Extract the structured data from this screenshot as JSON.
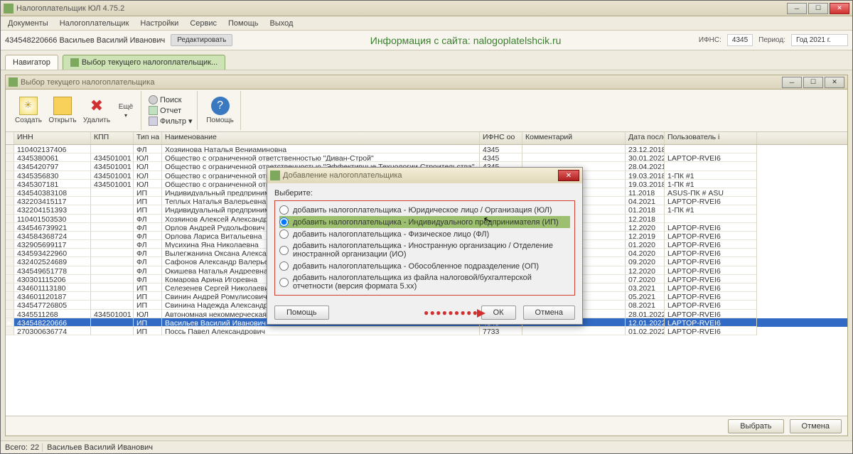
{
  "app": {
    "title": "Налогоплательщик ЮЛ 4.75.2",
    "menus": [
      "Документы",
      "Налогоплательщик",
      "Настройки",
      "Сервис",
      "Помощь",
      "Выход"
    ]
  },
  "strip": {
    "payer": "434548220666 Васильев Василий Иванович",
    "edit": "Редактировать",
    "site": "Информация с сайта: nalogoplatelshcik.ru",
    "ifns_l": "ИФНС:",
    "ifns_v": "4345",
    "period_l": "Период:",
    "period_v": "Год 2021 г."
  },
  "tabs": {
    "navigator": "Навигатор",
    "selector": "Выбор текущего налогоплательщик..."
  },
  "child": {
    "title": "Выбор текущего налогоплательщика"
  },
  "ribbon": {
    "create": "Создать",
    "open": "Открыть",
    "delete": "Удалить",
    "more": "Ещё",
    "help": "Помощь",
    "search": "Поиск",
    "report": "Отчет",
    "filter": "Фильтр ▾"
  },
  "cols": {
    "inn": "ИНН",
    "kpp": "КПП",
    "typ": "Тип на",
    "name": "Наименование",
    "ifns": "ИФНС оо",
    "comm": "Комментарий",
    "date": "Дата последн",
    "user": "Пользователь і"
  },
  "rows": [
    {
      "inn": "110402137406",
      "kpp": "",
      "typ": "ФЛ",
      "name": "Хозяинова Наталья Вениаминовна",
      "ifns": "4345",
      "comm": "",
      "date": "23.12.2018",
      "user": ""
    },
    {
      "inn": "4345380061",
      "kpp": "434501001",
      "typ": "ЮЛ",
      "name": "Общество с ограниченной ответственностью \"Диван-Строй\"",
      "ifns": "4345",
      "comm": "",
      "date": "30.01.2022",
      "user": "LAPTOP-RVEI6"
    },
    {
      "inn": "4345420797",
      "kpp": "434501001",
      "typ": "ЮЛ",
      "name": "Общество с ограниченной ответственностью \"Эффективные Технологии Строительства\"",
      "ifns": "4345",
      "comm": "",
      "date": "28.04.2021",
      "user": ""
    },
    {
      "inn": "4345356830",
      "kpp": "434501001",
      "typ": "ЮЛ",
      "name": "Общество с ограниченной ответственностью \"МегаСтройПлит\"",
      "ifns": "4345",
      "comm": "",
      "date": "19.03.2018",
      "user": "1-ПК #1"
    },
    {
      "inn": "4345307181",
      "kpp": "434501001",
      "typ": "ЮЛ",
      "name": "Общество с ограниченной ответственностью Торговая Компания \"Мегастройплит\"",
      "ifns": "4345",
      "comm": "",
      "date": "19.03.2018",
      "user": "1-ПК #1"
    },
    {
      "inn": "434540383108",
      "kpp": "",
      "typ": "ИП",
      "name": "Индивидуальный предприниматель Трубочкин Паве",
      "ifns": "",
      "comm": "",
      "date": "11.2018",
      "user": "ASUS-ПК # ASU"
    },
    {
      "inn": "432203415117",
      "kpp": "",
      "typ": "ИП",
      "name": "Теплых Наталья Валерьевна",
      "ifns": "",
      "comm": "",
      "date": "04.2021",
      "user": "LAPTOP-RVEI6"
    },
    {
      "inn": "432204151393",
      "kpp": "",
      "typ": "ИП",
      "name": "Индивидуальный предприниматель Коровкин Андре",
      "ifns": "",
      "comm": "",
      "date": "01.2018",
      "user": "1-ПК #1"
    },
    {
      "inn": "110401503530",
      "kpp": "",
      "typ": "ФЛ",
      "name": "Хозяинов Алексей Александрович",
      "ifns": "",
      "comm": "",
      "date": "12.2018",
      "user": ""
    },
    {
      "inn": "434546739921",
      "kpp": "",
      "typ": "ФЛ",
      "name": "Орлов Андрей Рудольфович",
      "ifns": "",
      "comm": "",
      "date": "12.2020",
      "user": "LAPTOP-RVEI6"
    },
    {
      "inn": "434584368724",
      "kpp": "",
      "typ": "ФЛ",
      "name": "Орлова Лариса Витальевна",
      "ifns": "",
      "comm": "",
      "date": "12.2019",
      "user": "LAPTOP-RVEI6"
    },
    {
      "inn": "432905699117",
      "kpp": "",
      "typ": "ФЛ",
      "name": "Мусихина Яна Николаевна",
      "ifns": "",
      "comm": "",
      "date": "01.2020",
      "user": "LAPTOP-RVEI6"
    },
    {
      "inn": "434593422960",
      "kpp": "",
      "typ": "ФЛ",
      "name": "Вылегжанина Оксана Александровна",
      "ifns": "",
      "comm": "",
      "date": "04.2020",
      "user": "LAPTOP-RVEI6"
    },
    {
      "inn": "432402524689",
      "kpp": "",
      "typ": "ФЛ",
      "name": "Сафонов Александр Валерьевич",
      "ifns": "",
      "comm": "",
      "date": "09.2020",
      "user": "LAPTOP-RVEI6"
    },
    {
      "inn": "434549651778",
      "kpp": "",
      "typ": "ФЛ",
      "name": "Окишева Наталья Андреевна",
      "ifns": "",
      "comm": "",
      "date": "12.2020",
      "user": "LAPTOP-RVEI6"
    },
    {
      "inn": "430301115206",
      "kpp": "",
      "typ": "ФЛ",
      "name": "Комарова Арина Игоревна",
      "ifns": "",
      "comm": "",
      "date": "07.2020",
      "user": "LAPTOP-RVEI6"
    },
    {
      "inn": "434601113180",
      "kpp": "",
      "typ": "ИП",
      "name": "Селезенев Сергей Николаевич",
      "ifns": "",
      "comm": "",
      "date": "03.2021",
      "user": "LAPTOP-RVEI6"
    },
    {
      "inn": "434601120187",
      "kpp": "",
      "typ": "ИП",
      "name": "Свинин Андрей Ромулисович",
      "ifns": "",
      "comm": "",
      "date": "05.2021",
      "user": "LAPTOP-RVEI6"
    },
    {
      "inn": "434547726805",
      "kpp": "",
      "typ": "ИП",
      "name": "Свинина Надежда Александровна",
      "ifns": "",
      "comm": "",
      "date": "08.2021",
      "user": "LAPTOP-RVEI6"
    },
    {
      "inn": "4345511268",
      "kpp": "434501001",
      "typ": "ЮЛ",
      "name": "Автономная некоммерческая организация \"Центр по оказанию услуг  развития и коррекции высших психических фу 4345",
      "ifns": "",
      "comm": "",
      "date": "28.01.2022",
      "user": "LAPTOP-RVEI6"
    },
    {
      "inn": "434548220666",
      "kpp": "",
      "typ": "ИП",
      "name": "Васильев Василий Иванович",
      "ifns": "4345",
      "comm": "",
      "date": "12.01.2022",
      "user": "LAPTOP-RVEI6",
      "selected": true
    },
    {
      "inn": "270300636774",
      "kpp": "",
      "typ": "ИП",
      "name": "Поссь Павел Александрович",
      "ifns": "7733",
      "comm": "",
      "date": "01.02.2022",
      "user": "LAPTOP-RVEI6"
    }
  ],
  "footer": {
    "select": "Выбрать",
    "cancel": "Отмена"
  },
  "status": {
    "count_l": "Всего:",
    "count": "22",
    "current": "Васильев Василий Иванович"
  },
  "modal": {
    "title": "Добавление налогоплательщика",
    "heading": "Выберите:",
    "options": [
      "добавить налогоплательщика - Юридическое лицо / Организация (ЮЛ)",
      "добавить налогоплательщика - Индивидуального предпринимателя (ИП)",
      "добавить налогоплательщика - Физическое лицо (ФЛ)",
      "добавить налогоплательщика - Иностранную организацию / Отделение иностранной организации (ИО)",
      "добавить налогоплательщика - Обособленное подразделение (ОП)",
      "добавить налогоплательщика из файла налоговой/бухгалтерской отчетности (версия формата 5.xx)"
    ],
    "selected": 1,
    "help": "Помощь",
    "ok": "ОК",
    "cancel": "Отмена"
  }
}
